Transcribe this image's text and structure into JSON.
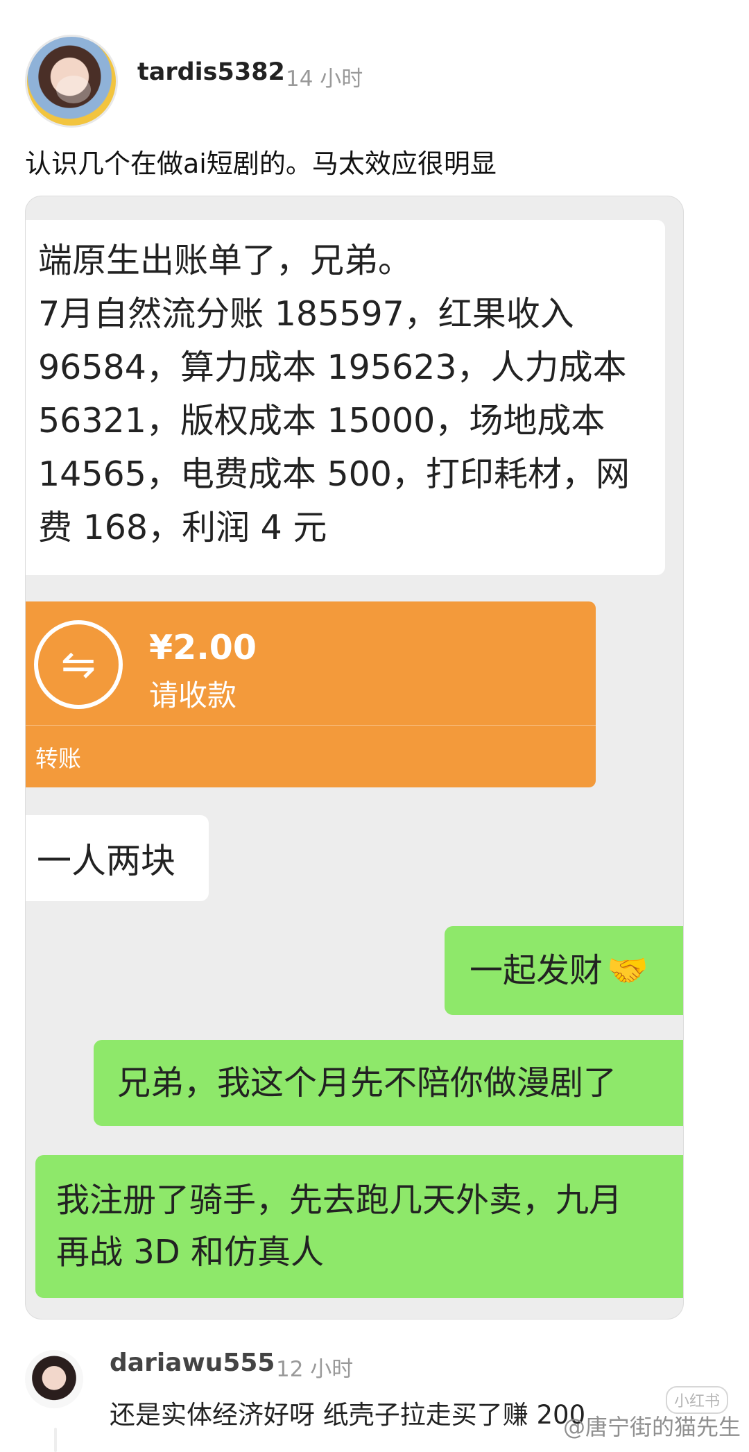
{
  "post": {
    "username": "tardis5382",
    "time": "14 小时",
    "text": "认识几个在做ai短剧的。马太效应很明显"
  },
  "screenshot": {
    "message1": "端原生出账单了，兄弟。\n7月自然流分账 185597，红果收入\n96584，算力成本 195623，人力成本\n56321，版权成本 15000，场地成本\n14565，电费成本 500，打印耗材，网\n费 168，利润 4 元",
    "transfer": {
      "icon": "⇋",
      "amount": "¥2.00",
      "status": "请收款",
      "label": "转账"
    },
    "message2": "一人两块",
    "green1": "一起发财",
    "green1_emoji": "🤝",
    "green2": "兄弟，我这个月先不陪你做漫剧了",
    "green3": "我注册了骑手，先去跑几天外卖，九月\n再战 3D 和仿真人"
  },
  "comment": {
    "username": "dariawu555",
    "time": "12 小时",
    "text": "还是实体经济好呀 纸壳子拉走买了赚 200"
  },
  "overlay": {
    "watermark": "@唐宁街的猫先生",
    "badge": "小红书"
  }
}
